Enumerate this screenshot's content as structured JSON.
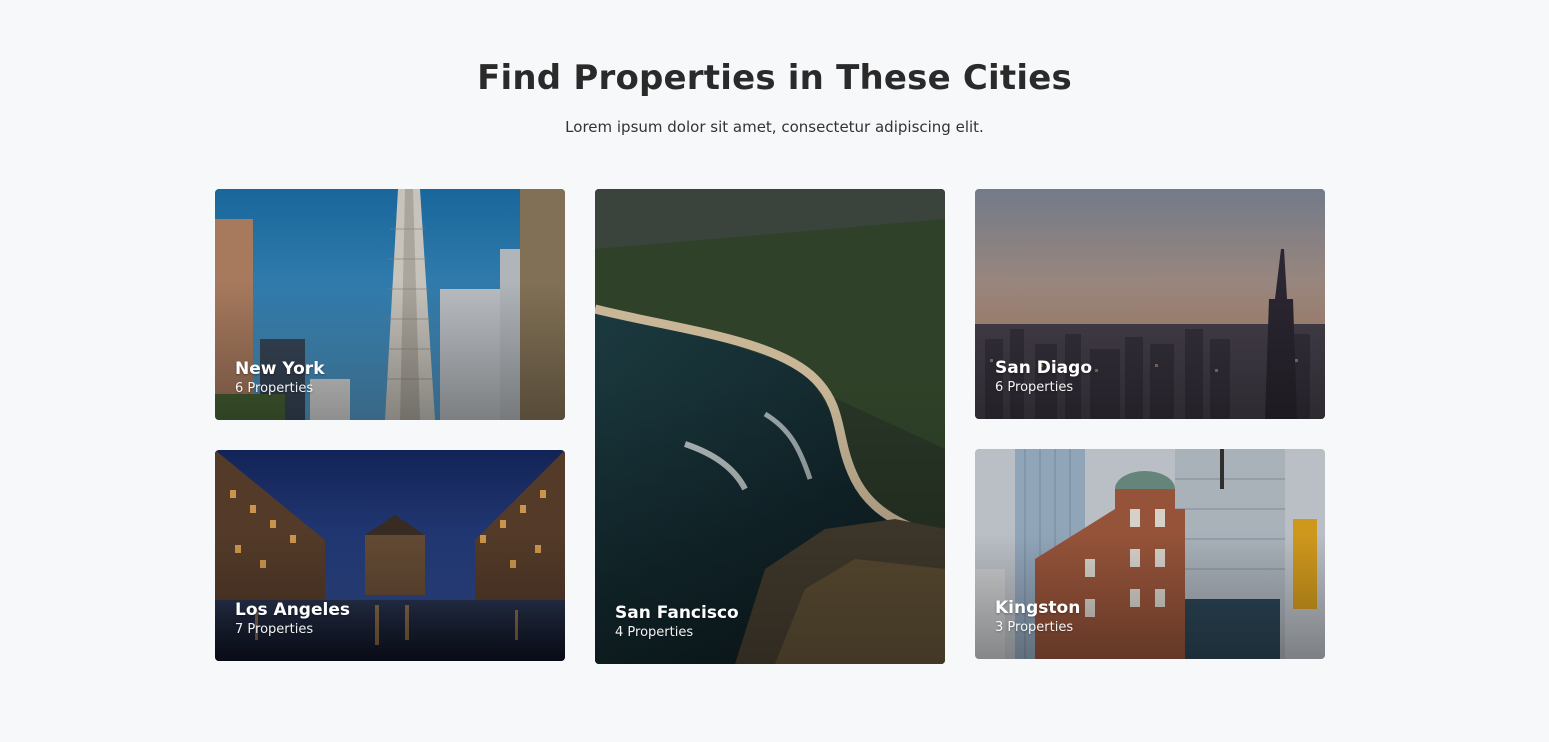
{
  "section": {
    "title": "Find Properties in These Cities",
    "subtitle": "Lorem ipsum dolor sit amet, consectetur adipiscing elit."
  },
  "cities": [
    {
      "name": "New York",
      "count": "6 Properties",
      "image": "skyscraper-photo"
    },
    {
      "name": "Los Angeles",
      "count": "7 Properties",
      "image": "canal-night-photo"
    },
    {
      "name": "San Fancisco",
      "count": "4 Properties",
      "image": "coastline-aerial-photo"
    },
    {
      "name": "San Diago",
      "count": "6 Properties",
      "image": "skyline-dusk-photo"
    },
    {
      "name": "Kingston",
      "count": "3 Properties",
      "image": "street-buildings-photo"
    }
  ]
}
